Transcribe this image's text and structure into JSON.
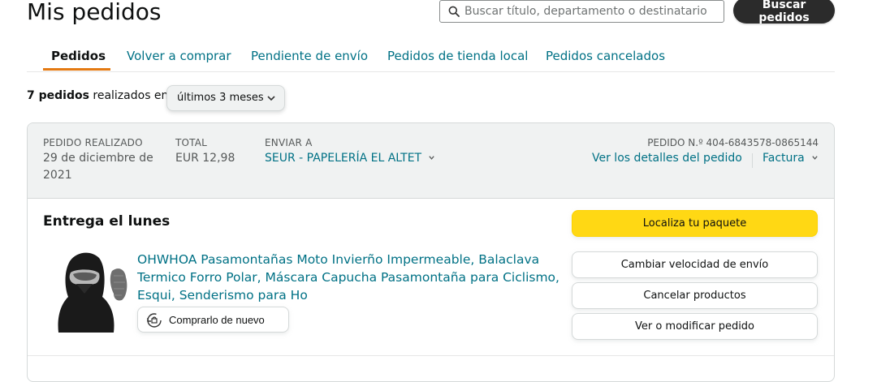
{
  "header": {
    "title": "Mis pedidos",
    "search_placeholder": "Buscar título, departamento o destinatario",
    "search_button": "Buscar pedidos"
  },
  "tabs": [
    {
      "label": "Pedidos",
      "active": true
    },
    {
      "label": "Volver a comprar"
    },
    {
      "label": "Pendiente de envío"
    },
    {
      "label": "Pedidos de tienda local"
    },
    {
      "label": "Pedidos cancelados"
    }
  ],
  "filter": {
    "count_bold": "7 pedidos",
    "count_rest": "realizados en",
    "range_value": "últimos 3 meses"
  },
  "order": {
    "placed_label": "PEDIDO REALIZADO",
    "placed_date_line1": "29 de diciembre de",
    "placed_date_line2": "2021",
    "total_label": "TOTAL",
    "total_value": "EUR 12,98",
    "ship_label": "ENVIAR A",
    "ship_value": "SEUR - PAPELERÍA EL ALTET",
    "order_number": "PEDIDO N.º 404-6843578-0865144",
    "details_link": "Ver los detalles del pedido",
    "invoice_link": "Factura",
    "delivery_status": "Entrega el lunes",
    "product_title": "OHWHOA Pasamontañas Moto Invierño Impermeable, Balaclava Termico Forro Polar, Máscara Capucha Pasamontaña para Ciclismo, Esqui, Senderismo para Ho",
    "rebuy_button": "Comprarlo de nuevo",
    "actions": [
      {
        "label": "Localiza tu paquete"
      },
      {
        "label": "Cambiar velocidad de envío"
      },
      {
        "label": "Cancelar productos"
      },
      {
        "label": "Ver o modificar pedido"
      }
    ]
  },
  "colors": {
    "link": "#007185",
    "tab_underline": "#e47911",
    "primary_button": "#ffd814",
    "search_button": "#2b2b2b"
  },
  "icons": [
    "search-icon",
    "chevron-down-icon",
    "buy-again-icon"
  ]
}
